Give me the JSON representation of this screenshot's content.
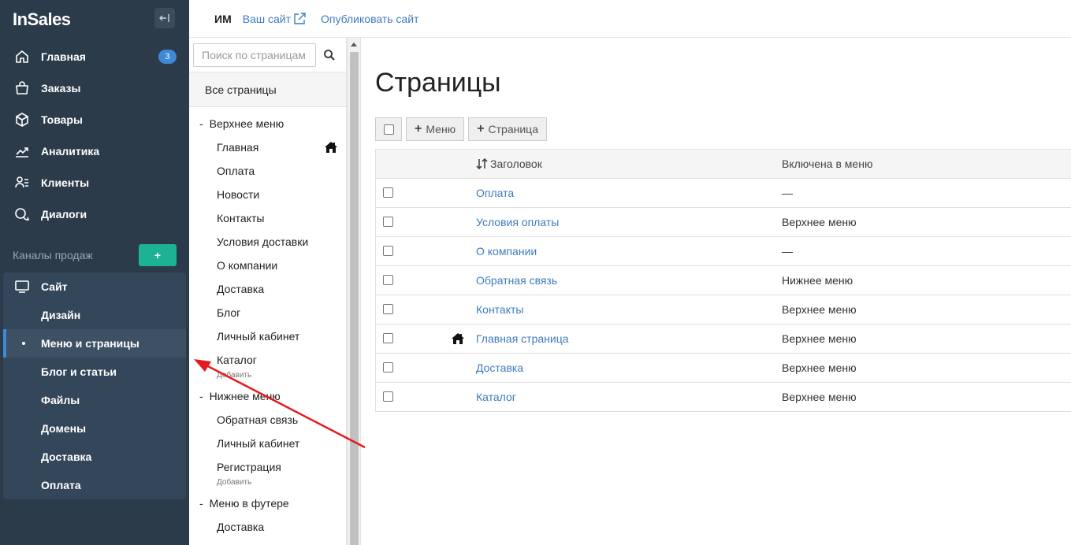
{
  "app": {
    "logo": "InSales"
  },
  "sidebar": {
    "nav": [
      {
        "label": "Главная",
        "icon": "home-icon",
        "badge": "3"
      },
      {
        "label": "Заказы",
        "icon": "bag-icon"
      },
      {
        "label": "Товары",
        "icon": "box-icon"
      },
      {
        "label": "Аналитика",
        "icon": "chart-icon"
      },
      {
        "label": "Клиенты",
        "icon": "clients-icon"
      },
      {
        "label": "Диалоги",
        "icon": "chat-icon"
      }
    ],
    "channels_label": "Каналы продаж",
    "channels_add": "+",
    "site": {
      "label": "Сайт",
      "items": [
        "Дизайн",
        "Меню и страницы",
        "Блог и статьи",
        "Файлы",
        "Домены",
        "Доставка",
        "Оплата"
      ],
      "active": "Меню и страницы"
    }
  },
  "topbar": {
    "store_name": "ИМ",
    "site_link": "Ваш сайт",
    "publish_link": "Опубликовать сайт"
  },
  "tree": {
    "search_placeholder": "Поиск по страницам",
    "all_pages": "Все страницы",
    "groups": [
      {
        "name": "Верхнее меню",
        "items": [
          "Главная",
          "Оплата",
          "Новости",
          "Контакты",
          "Условия доставки",
          "О компании",
          "Доставка",
          "Блог",
          "Личный кабинет",
          "Каталог"
        ],
        "add": "Добавить"
      },
      {
        "name": "Нижнее меню",
        "items": [
          "Обратная связь",
          "Личный кабинет",
          "Регистрация"
        ],
        "add": "Добавить"
      },
      {
        "name": "Меню в футере",
        "items": [
          "Доставка"
        ]
      }
    ]
  },
  "main": {
    "title": "Страницы",
    "btn_menu": "Меню",
    "btn_page": "Страница",
    "columns": {
      "title": "Заголовок",
      "menu": "Включена в меню"
    },
    "rows": [
      {
        "title": "Оплата",
        "menu": "—",
        "home": false
      },
      {
        "title": "Условия оплаты",
        "menu": "Верхнее меню",
        "home": false
      },
      {
        "title": "О компании",
        "menu": "—",
        "home": false
      },
      {
        "title": "Обратная связь",
        "menu": "Нижнее меню",
        "home": false
      },
      {
        "title": "Контакты",
        "menu": "Верхнее меню",
        "home": false
      },
      {
        "title": "Главная страница",
        "menu": "Верхнее меню",
        "home": true
      },
      {
        "title": "Доставка",
        "menu": "Верхнее меню",
        "home": false
      },
      {
        "title": "Каталог",
        "menu": "Верхнее меню",
        "home": false
      }
    ]
  },
  "colors": {
    "sidebar": "#2c3b4a",
    "accent": "#3e89d8",
    "green": "#1bb394",
    "link": "#3e7bbf",
    "arrow": "#e8191c"
  }
}
